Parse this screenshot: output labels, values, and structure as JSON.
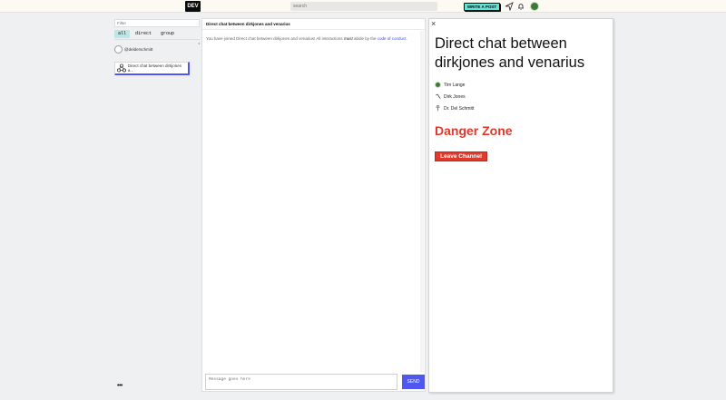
{
  "header": {
    "logo_text": "DEV",
    "search_placeholder": "search",
    "write_post_label": "WRITE A POST",
    "icons": [
      "connect-icon",
      "bell-icon",
      "user-avatar"
    ]
  },
  "sidebar": {
    "filter_placeholder": "Filter",
    "chips": [
      "all",
      "direct",
      "group"
    ],
    "active_chip": "all",
    "channels": [
      {
        "label": "@delderschmitt",
        "icon": "avatar-icon"
      },
      {
        "label": "Direct chat between dirkjones a...",
        "icon": "group-icon",
        "active": true
      }
    ],
    "more_label": "•••"
  },
  "chat": {
    "title": "Direct chat between dirkjones and venarius",
    "msg_prefix": "You have joined Direct chat between dirkjones and venarius! All interactions ",
    "msg_em": "must",
    "msg_mid": " abide by the ",
    "msg_link": "code of conduct",
    "msg_suffix": ".",
    "composer_placeholder": "Message goes here",
    "send_label": "SEND"
  },
  "details": {
    "title": "Direct chat between dirkjones and venarius",
    "members": [
      {
        "name": "Tim Lange",
        "color": "#3d7a36"
      },
      {
        "name": "Dirk Jones",
        "color": "#777777"
      },
      {
        "name": "Dr. Del Schmitt",
        "color": "#999999"
      }
    ],
    "danger_title": "Danger Zone",
    "leave_label": "Leave Channel",
    "close_symbol": "×"
  },
  "colors": {
    "accent": "#4e57ef",
    "danger": "#e0382b",
    "write_btn": "#66e2d5",
    "chip_active": "#bfe5e7"
  }
}
